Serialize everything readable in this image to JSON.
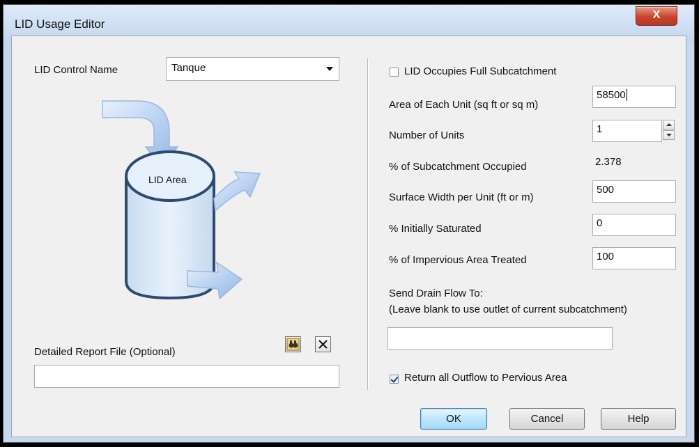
{
  "window": {
    "title": "LID Usage Editor",
    "close_glyph": "X"
  },
  "left": {
    "lid_control_label": "LID Control Name",
    "lid_control_value": "Tanque",
    "diagram_label": "LID Area",
    "report_file_label": "Detailed Report File (Optional)",
    "report_file_value": ""
  },
  "right": {
    "full_subcatchment_label": "LID Occupies Full Subcatchment",
    "full_subcatchment_checked": false,
    "area_label": "Area of Each Unit (sq ft or sq m)",
    "area_value": "58500",
    "units_label": "Number of Units",
    "units_value": "1",
    "occupied_label": "% of Subcatchment Occupied",
    "occupied_value": "2.378",
    "width_label": "Surface Width per Unit (ft or m)",
    "width_value": "500",
    "saturated_label": "% Initially Saturated",
    "saturated_value": "0",
    "impervious_label": "% of Impervious Area Treated",
    "impervious_value": "100",
    "drain_label": "Send Drain Flow To:",
    "drain_hint": "(Leave blank to use outlet of current subcatchment)",
    "drain_value": "",
    "return_outflow_label": "Return all Outflow to Pervious Area",
    "return_outflow_checked": true
  },
  "buttons": {
    "ok": "OK",
    "cancel": "Cancel",
    "help": "Help"
  },
  "icons": {
    "browse": "browse-binoculars-icon",
    "clear": "clear-x-icon"
  },
  "colors": {
    "title_bar": "#c9d9ec",
    "close_button": "#c7442b",
    "arrow_fill": "#a9c8ee",
    "tank_fill": "#dceaf7",
    "tank_stroke": "#2e4a70"
  }
}
